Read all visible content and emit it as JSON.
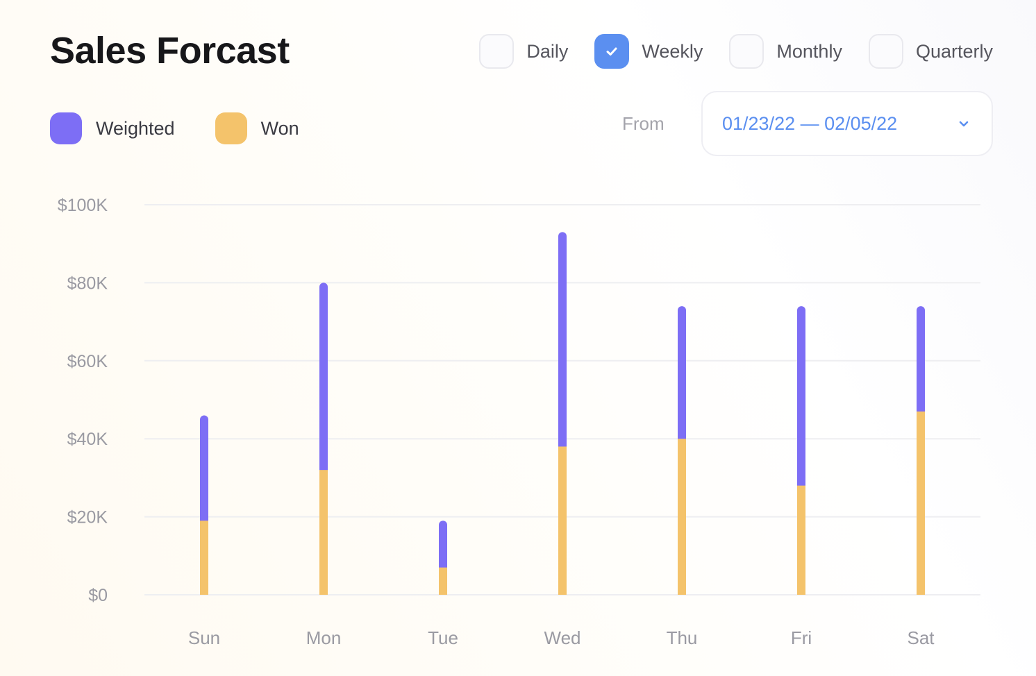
{
  "header": {
    "title": "Sales Forcast"
  },
  "period_options": [
    {
      "label": "Daily",
      "checked": false
    },
    {
      "label": "Weekly",
      "checked": true
    },
    {
      "label": "Monthly",
      "checked": false
    },
    {
      "label": "Quarterly",
      "checked": false
    }
  ],
  "legend": {
    "weighted": {
      "label": "Weighted",
      "color": "#7d6ef5"
    },
    "won": {
      "label": "Won",
      "color": "#f4c36b"
    }
  },
  "date_range": {
    "from_label": "From",
    "value": "01/23/22 — 02/05/22"
  },
  "colors": {
    "accent": "#5b8ff0",
    "weighted": "#7d6ef5",
    "won": "#f4c36b",
    "grid": "#eeeef1",
    "tick": "#9a9aa2"
  },
  "chart_data": {
    "type": "bar",
    "stacked": true,
    "categories": [
      "Sun",
      "Mon",
      "Tue",
      "Wed",
      "Thu",
      "Fri",
      "Sat"
    ],
    "series": [
      {
        "name": "Won",
        "values": [
          19000,
          32000,
          7000,
          38000,
          40000,
          28000,
          47000
        ]
      },
      {
        "name": "Weighted",
        "values": [
          27000,
          48000,
          12000,
          55000,
          34000,
          46000,
          27000
        ]
      }
    ],
    "y_ticks": [
      {
        "value": 0,
        "label": "$0"
      },
      {
        "value": 20000,
        "label": "$20K"
      },
      {
        "value": 40000,
        "label": "$40K"
      },
      {
        "value": 60000,
        "label": "$60K"
      },
      {
        "value": 80000,
        "label": "$80K"
      },
      {
        "value": 100000,
        "label": "$100K"
      }
    ],
    "ylim": [
      0,
      100000
    ],
    "grid": true,
    "legend_position": "top-left"
  }
}
